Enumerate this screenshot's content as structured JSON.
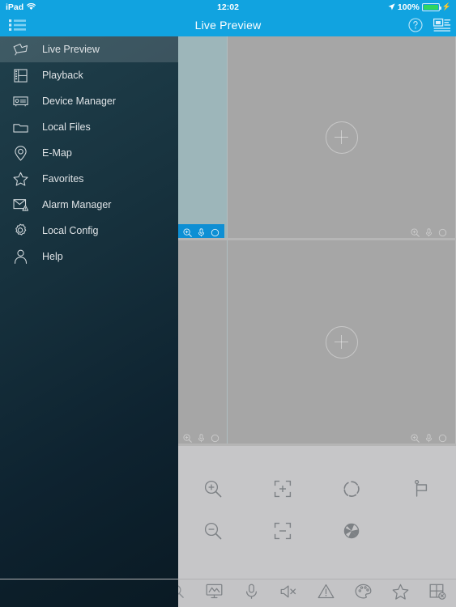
{
  "statusbar": {
    "device": "iPad",
    "wifi_icon": "wifi-icon",
    "time": "12:02",
    "location_icon": "location-arrow-icon",
    "battery_percent": "100%",
    "battery_icon": "battery-full-icon",
    "charging_icon": "lightning-bolt-icon"
  },
  "navbar": {
    "title": "Live Preview",
    "menu_icon": "list-menu-icon",
    "help_icon": "help-circle-icon",
    "device_list_icon": "device-list-icon"
  },
  "sidebar": {
    "items": [
      {
        "label": "Live Preview",
        "icon": "camera-icon",
        "active": true
      },
      {
        "label": "Playback",
        "icon": "film-strip-icon",
        "active": false
      },
      {
        "label": "Device Manager",
        "icon": "device-box-icon",
        "active": false
      },
      {
        "label": "Local Files",
        "icon": "folder-icon",
        "active": false
      },
      {
        "label": "E-Map",
        "icon": "map-pin-icon",
        "active": false
      },
      {
        "label": "Favorites",
        "icon": "star-icon",
        "active": false
      },
      {
        "label": "Alarm Manager",
        "icon": "alarm-mail-icon",
        "active": false
      },
      {
        "label": "Local Config",
        "icon": "gear-icon",
        "active": false
      },
      {
        "label": "Help",
        "icon": "person-icon",
        "active": false
      }
    ]
  },
  "video": {
    "rows": [
      {
        "sliver_selected": true,
        "cells": [
          {
            "kind": "sliver",
            "selected": true,
            "placeholder": "+"
          },
          {
            "kind": "main",
            "selected": false,
            "placeholder": "+"
          }
        ]
      },
      {
        "sliver_selected": false,
        "cells": [
          {
            "kind": "sliver",
            "selected": false,
            "placeholder": "+"
          },
          {
            "kind": "main",
            "selected": false,
            "placeholder": "+"
          }
        ]
      }
    ],
    "cell_tools": [
      {
        "icon": "zoom-in-icon"
      },
      {
        "icon": "microphone-icon"
      },
      {
        "icon": "record-circle-icon"
      }
    ],
    "add_placeholder": "+"
  },
  "ptz": {
    "buttons": [
      {
        "label": "Zoom In",
        "icon": "magnifier-plus-icon"
      },
      {
        "label": "Focus Near",
        "icon": "focus-plus-icon"
      },
      {
        "label": "Iris Open",
        "icon": "iris-open-icon"
      },
      {
        "label": "Preset",
        "icon": "flag-icon"
      },
      {
        "label": "Zoom Out",
        "icon": "magnifier-minus-icon"
      },
      {
        "label": "Focus Far",
        "icon": "focus-minus-icon"
      },
      {
        "label": "Iris Close",
        "icon": "iris-close-icon"
      }
    ]
  },
  "tabbar": {
    "items": [
      {
        "label": "PTZ",
        "icon": "magnifier-icon"
      },
      {
        "label": "Stream",
        "icon": "monitor-wave-icon"
      },
      {
        "label": "Talk",
        "icon": "microphone-icon"
      },
      {
        "label": "Audio",
        "icon": "speaker-mute-icon"
      },
      {
        "label": "Alarm",
        "icon": "warning-triangle-icon"
      },
      {
        "label": "Image",
        "icon": "palette-icon"
      },
      {
        "label": "Favorite",
        "icon": "star-icon"
      },
      {
        "label": "Close All",
        "icon": "grid-close-icon"
      }
    ]
  },
  "colors": {
    "accent": "#11a3e0",
    "sidebar_top": "#20404c",
    "sidebar_bottom": "#0a1a24",
    "panel_gray": "#a6a6a6",
    "sliver_teal": "#9db6ba",
    "ptz_bg": "#c6c6c8",
    "tabbar_bg": "#c4c4c6",
    "battery_green": "#2fd65f"
  }
}
